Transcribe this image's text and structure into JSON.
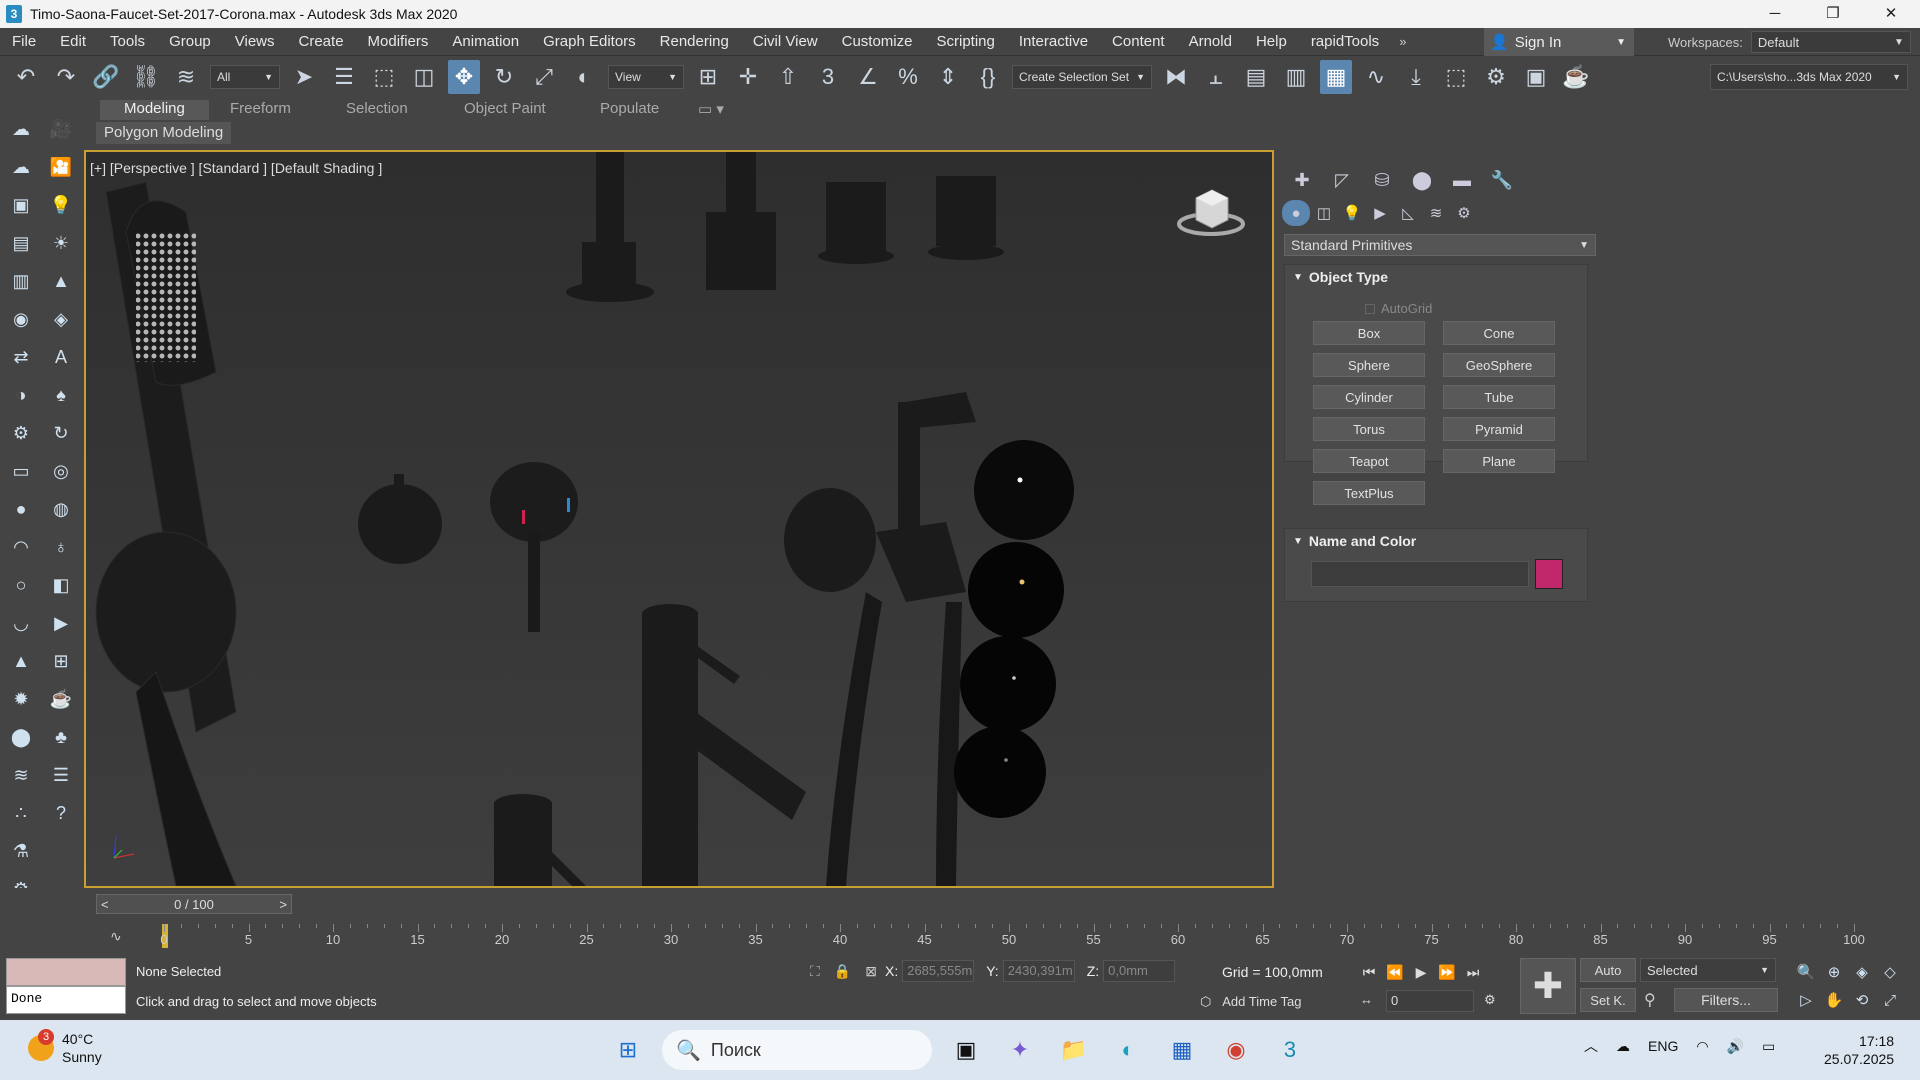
{
  "window": {
    "app_icon": "3",
    "title": "Timo-Saona-Faucet-Set-2017-Corona.max - Autodesk 3ds Max 2020",
    "controls": [
      "minimize-icon",
      "restore-icon",
      "close-icon"
    ]
  },
  "menu": {
    "items": [
      "File",
      "Edit",
      "Tools",
      "Group",
      "Views",
      "Create",
      "Modifiers",
      "Animation",
      "Graph Editors",
      "Rendering",
      "Civil View",
      "Customize",
      "Scripting",
      "Interactive",
      "Content",
      "Arnold",
      "Help",
      "rapidTools"
    ],
    "more": "»",
    "sign_in": "Sign In",
    "workspaces_label": "Workspaces:",
    "workspace_value": "Default"
  },
  "toolbar": {
    "filter_value": "All",
    "refcoord_value": "View",
    "selection_set": "Create Selection Set",
    "project_path": "C:\\Users\\sho...3ds Max 2020"
  },
  "ribbon": {
    "tabs": [
      "Modeling",
      "Freeform",
      "Selection",
      "Object Paint",
      "Populate"
    ],
    "active_tab": "Modeling",
    "subpanel": "Polygon Modeling"
  },
  "viewport": {
    "label": "[+] [Perspective ] [Standard ] [Default Shading ]"
  },
  "command_panel": {
    "category": "Standard Primitives",
    "object_type": {
      "header": "Object Type",
      "autogrid": "AutoGrid",
      "buttons": [
        "Box",
        "Cone",
        "Sphere",
        "GeoSphere",
        "Cylinder",
        "Tube",
        "Torus",
        "Pyramid",
        "Teapot",
        "Plane",
        "TextPlus"
      ]
    },
    "name_color": {
      "header": "Name and Color",
      "name_value": "",
      "color": "#c1286c"
    }
  },
  "timeline": {
    "slider_value": "0 / 100",
    "ticks": [
      0,
      5,
      10,
      15,
      20,
      25,
      30,
      35,
      40,
      45,
      50,
      55,
      60,
      65,
      70,
      75,
      80,
      85,
      90,
      95,
      100
    ]
  },
  "status": {
    "maxscript_output": "Done",
    "selection": "None Selected",
    "prompt": "Click and drag to select and move objects",
    "x_label": "X:",
    "x_value": "2685,555m",
    "y_label": "Y:",
    "y_value": "2430,391m",
    "z_label": "Z:",
    "z_value": "0,0mm",
    "grid": "Grid = 100,0mm",
    "add_time_tag": "Add Time Tag",
    "frame_value": "0",
    "auto_key": "Auto",
    "set_key": "Set K.",
    "key_filter_value": "Selected",
    "filters": "Filters..."
  },
  "taskbar": {
    "weather_badge": "3",
    "temperature": "40°C",
    "condition": "Sunny",
    "search_placeholder": "Поиск",
    "language": "ENG",
    "time": "17:18",
    "date": "25.07.2025"
  }
}
